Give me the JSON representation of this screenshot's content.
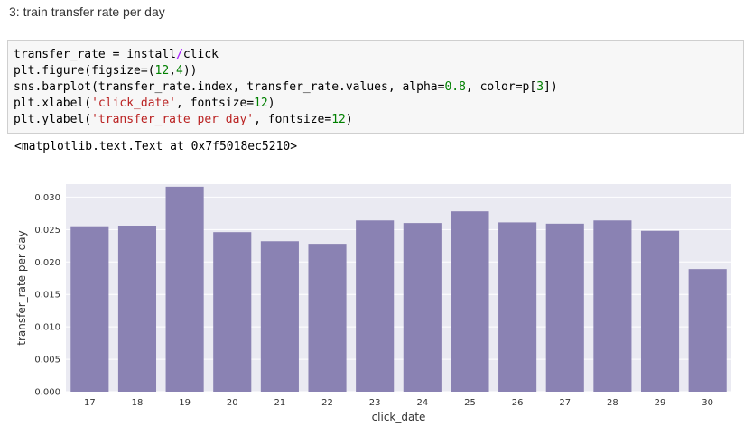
{
  "cell": {
    "heading": "3: train transfer rate per day",
    "code": {
      "line1": {
        "a": "transfer_rate = install",
        "op": "/",
        "b": "click"
      },
      "line2": {
        "a": "plt.figure(figsize=(",
        "n1": "12",
        "sep": ",",
        "n2": "4",
        "b": "))"
      },
      "line3": {
        "a": "sns.barplot(transfer_rate.index, transfer_rate.values, alpha=",
        "n1": "0.8",
        "b": ", color=p[",
        "n2": "3",
        "c": "])"
      },
      "line4": {
        "a": "plt.xlabel(",
        "s": "'click_date'",
        "b": ", fontsize=",
        "n": "12",
        "c": ")"
      },
      "line5": {
        "a": "plt.ylabel(",
        "s": "'transfer_rate per day'",
        "b": ", fontsize=",
        "n": "12",
        "c": ")"
      }
    },
    "output": "<matplotlib.text.Text at 0x7f5018ec5210>"
  },
  "chart_data": {
    "type": "bar",
    "categories": [
      "17",
      "18",
      "19",
      "20",
      "21",
      "22",
      "23",
      "24",
      "25",
      "26",
      "27",
      "28",
      "29",
      "30"
    ],
    "values": [
      0.0255,
      0.0256,
      0.0316,
      0.0246,
      0.0232,
      0.0228,
      0.0264,
      0.026,
      0.0278,
      0.0261,
      0.0259,
      0.0264,
      0.0248,
      0.0189
    ],
    "title": "",
    "xlabel": "click_date",
    "ylabel": "transfer_rate per day",
    "ylim": [
      0,
      0.032
    ],
    "yticks": [
      "0.000",
      "0.005",
      "0.010",
      "0.015",
      "0.020",
      "0.025",
      "0.030"
    ],
    "grid": true,
    "colors": {
      "bar": "#8a82b3",
      "background": "#eaeaf2",
      "grid": "#ffffff"
    }
  }
}
